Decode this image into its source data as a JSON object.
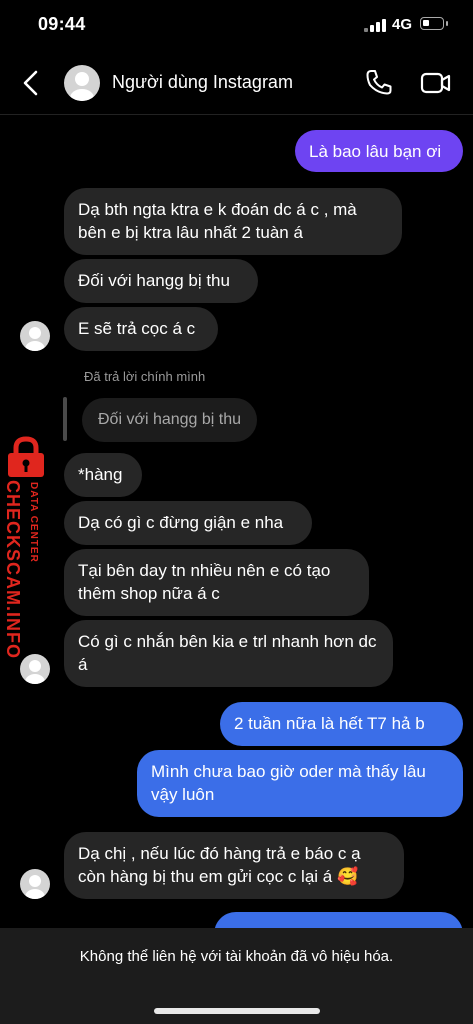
{
  "status_bar": {
    "time": "09:44",
    "network": "4G"
  },
  "header": {
    "contact_name": "Người dùng Instagram"
  },
  "messages": [
    {
      "text": "Là bao lâu bạn ơi"
    },
    {
      "text": "Dạ bth ngta ktra e k đoán dc á c , mà bên e bị ktra lâu nhất 2 tuàn á"
    },
    {
      "text": "Đối với hangg bị thu"
    },
    {
      "text": "E sẽ trả cọc á c"
    },
    {
      "text": "*hàng"
    },
    {
      "text": "Dạ có gì c đừng giận e nha"
    },
    {
      "text": "Tại bên day tn nhiều nên e có tạo thêm shop nữa á c"
    },
    {
      "text": "Có gì c nhắn bên kia e trl nhanh hơn dc á"
    },
    {
      "text": "2 tuần nữa là  hết T7 hả b"
    },
    {
      "text": "Mình chưa bao giờ oder mà thấy lâu vậy luôn"
    },
    {
      "text": "Dạ chị , nếu lúc đó hàng trả e báo c ạ còn hàng bị thu em gửi cọc c lại á 🥰"
    }
  ],
  "reply": {
    "caption": "Đã trả lời chính mình",
    "quoted_text": "Đối với hangg bị thu"
  },
  "watermark": {
    "main": "CHECKSCAM.INFO",
    "sub": "DATA CENTER"
  },
  "footer": {
    "notice": "Không thể liên hệ với tài khoản đã vô hiệu hóa."
  },
  "colors": {
    "outgoing_purple": "#6e44f2",
    "outgoing_blue": "#3b6ee8",
    "incoming": "#262626",
    "watermark_red": "#e0261e"
  }
}
